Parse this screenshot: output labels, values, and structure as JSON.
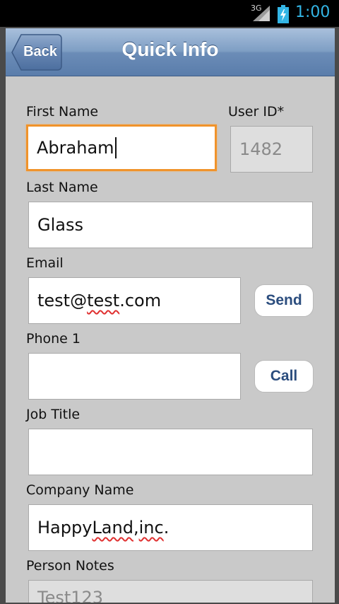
{
  "status_bar": {
    "network": "3G",
    "time": "1:00",
    "accent_color": "#33b5e5"
  },
  "navbar": {
    "back_label": "Back",
    "title": "Quick Info"
  },
  "form": {
    "first_name": {
      "label": "First Name",
      "value": "Abraham"
    },
    "user_id": {
      "label": "User ID*",
      "value": "1482"
    },
    "last_name": {
      "label": "Last Name",
      "value": "Glass"
    },
    "email": {
      "label": "Email",
      "value_prefix": "test@",
      "value_misspelled": "test",
      "value_suffix": ".com",
      "action": "Send"
    },
    "phone1": {
      "label": "Phone 1",
      "value": "",
      "action": "Call"
    },
    "job_title": {
      "label": "Job Title",
      "value": ""
    },
    "company_name": {
      "label": "Company Name",
      "value_part1": "Happy ",
      "value_word2": "Land",
      "value_part3": ", ",
      "value_word4": "inc",
      "value_part5": "."
    },
    "person_notes": {
      "label": "Person Notes",
      "value": "Test123"
    }
  },
  "colors": {
    "focus_border": "#f0932b",
    "nav_gradient_top": "#a9c0dc",
    "nav_gradient_bottom": "#5a7dab",
    "button_text": "#2b4d7e",
    "spellcheck": "#e03030"
  },
  "icons": [
    "signal-icon",
    "battery-icon"
  ]
}
